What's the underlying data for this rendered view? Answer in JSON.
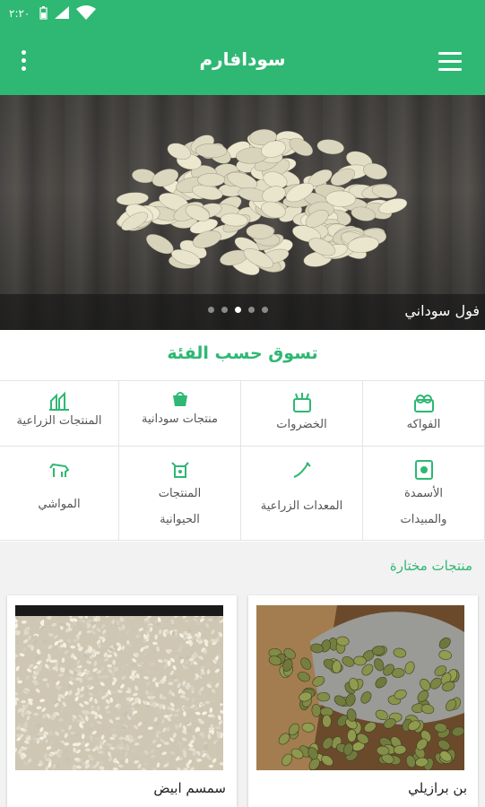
{
  "status_bar": {
    "time": "٢:٢٠"
  },
  "app_bar": {
    "title": "سودافارم"
  },
  "banner": {
    "caption": "فول سوداني",
    "slide_count": 5,
    "active_slide": 3
  },
  "categories": {
    "title": "تسوق حسب الفئة",
    "items": [
      {
        "label": "الفواكه",
        "icon": "fruits-icon"
      },
      {
        "label": "الخضروات",
        "icon": "vegetables-icon"
      },
      {
        "label": "منتجات سودانية",
        "icon": "sudanese-products-icon"
      },
      {
        "label": "المنتجات الزراعية",
        "icon": "agricultural-products-icon"
      },
      {
        "label": "الأسمدة\nوالمبيدات",
        "icon": "fertilizers-icon"
      },
      {
        "label": "المعدات الزراعية",
        "icon": "equipment-icon"
      },
      {
        "label": "المنتجات\nالحيوانية",
        "icon": "animal-products-icon"
      },
      {
        "label": "المواشي",
        "icon": "livestock-icon"
      }
    ]
  },
  "featured": {
    "title": "منتجات مختارة",
    "products": [
      {
        "name": "بن برازيلي"
      },
      {
        "name": "سمسم ابيض"
      }
    ]
  },
  "colors": {
    "primary": "#2eb873"
  }
}
